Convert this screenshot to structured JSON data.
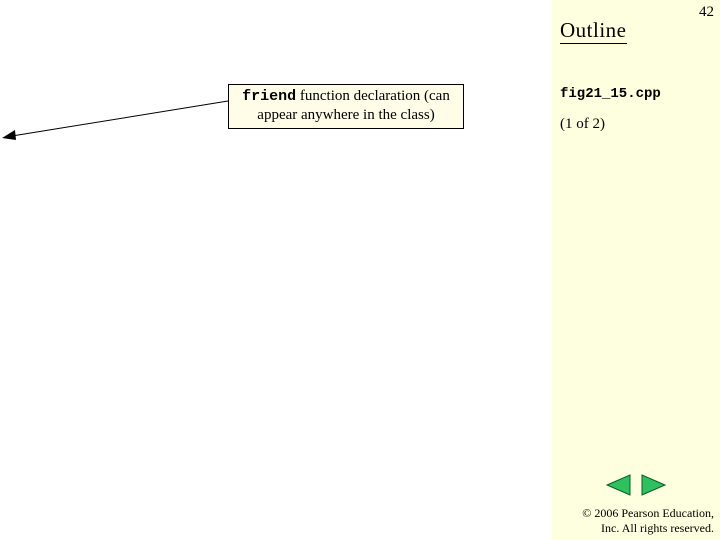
{
  "header": {
    "title": "Outline",
    "page_number": "42"
  },
  "sidebar": {
    "filename": "fig21_15.cpp",
    "part": "(1 of 2)"
  },
  "callout": {
    "keyword": "friend",
    "line1_rest": " function declaration (can",
    "line2": "appear anywhere in the class)"
  },
  "nav": {
    "prev_icon": "prev-triangle",
    "next_icon": "next-triangle"
  },
  "footer": {
    "copyright": "© 2006 Pearson Education,\nInc.  All rights reserved."
  }
}
